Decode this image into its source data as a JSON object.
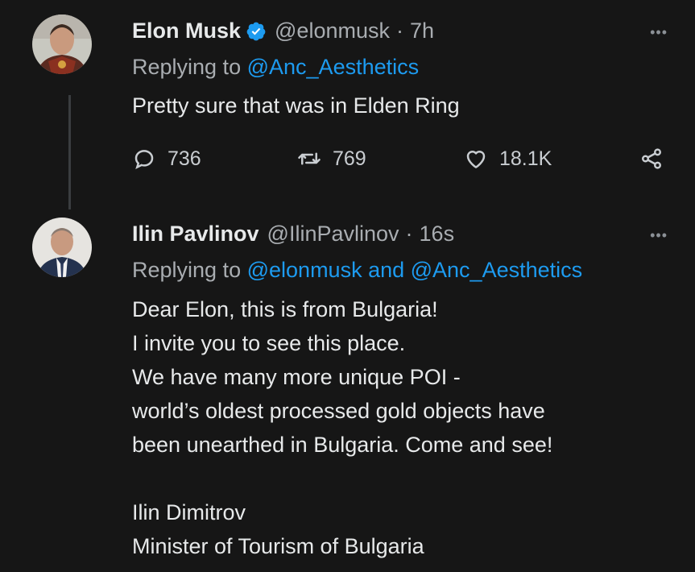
{
  "tweets": [
    {
      "author_name": "Elon Musk",
      "handle": "@elonmusk",
      "separator": "·",
      "time": "7h",
      "verified": true,
      "more": "•••",
      "reply_prefix": "Replying to",
      "reply_mentions": "@Anc_Aesthetics",
      "text": "Pretty sure that was in Elden Ring",
      "stats": {
        "replies": "736",
        "retweets": "769",
        "likes": "18.1K"
      }
    },
    {
      "author_name": "Ilin Pavlinov",
      "handle": "@IlinPavlinov",
      "separator": "·",
      "time": "16s",
      "more": "•••",
      "reply_prefix": "Replying to",
      "reply_mentions": "@elonmusk and @Anc_Aesthetics",
      "text_lines": [
        "Dear Elon, this is from Bulgaria!",
        "I invite you to see this place.",
        "We have many more unique POI -",
        "world’s oldest processed gold objects have",
        "been unearthed in Bulgaria. Come and see!",
        "",
        "Ilin Dimitrov",
        "Minister of Tourism of Bulgaria"
      ]
    }
  ],
  "colors": {
    "background": "#161616",
    "text": "#e7e9ea",
    "secondary": "#a9adb1",
    "link": "#1d9bf0",
    "verified": "#1d9bf0"
  },
  "icons": [
    "verified-badge-icon",
    "reply-icon",
    "retweet-icon",
    "like-icon",
    "share-icon",
    "more-options-icon"
  ]
}
